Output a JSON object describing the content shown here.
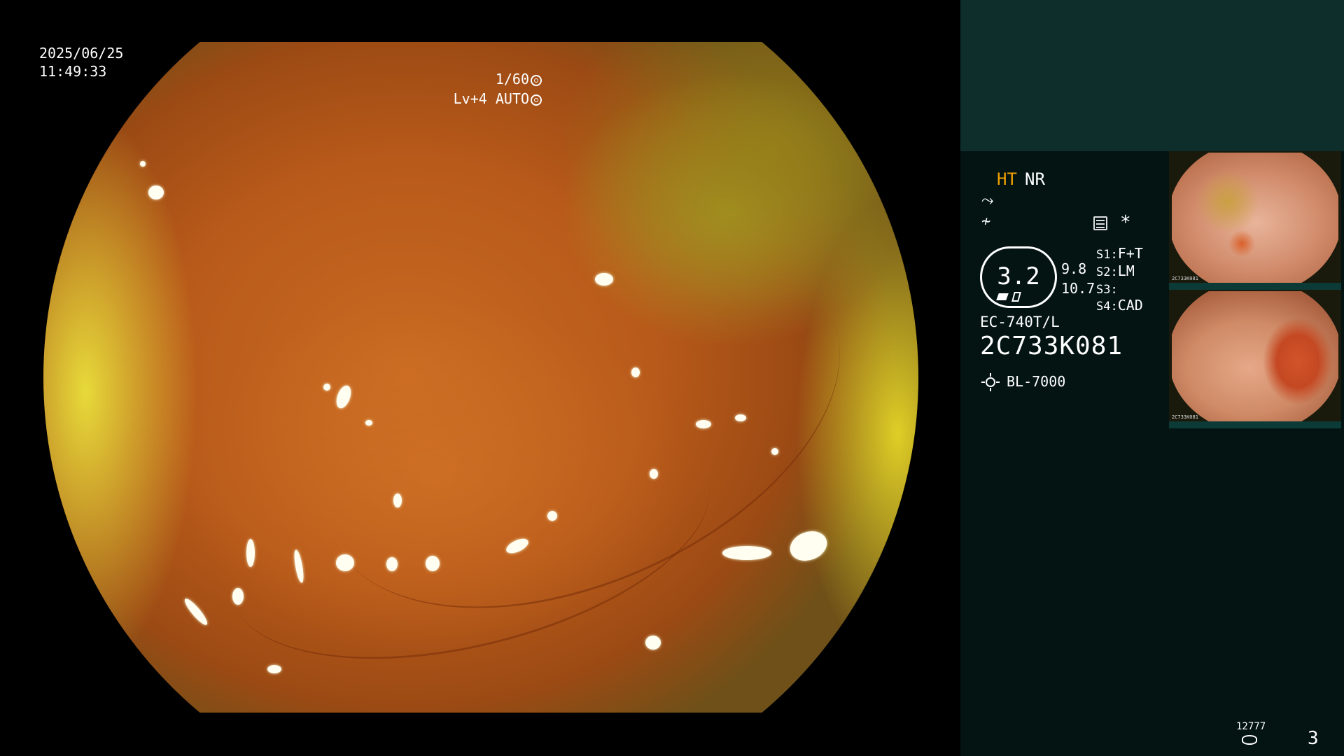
{
  "osd": {
    "date": "2025/06/25",
    "time": "11:49:33",
    "shutter": "1/60",
    "level": "Lv+4 AUTO"
  },
  "panel": {
    "mode_ht": "HT",
    "mode_nr": "NR",
    "gauge_value": "3.2",
    "value_a": "9.8",
    "value_b": "10.7",
    "slots": [
      {
        "key": "S1:",
        "value": "F+T"
      },
      {
        "key": "S2:",
        "value": "LM"
      },
      {
        "key": "S3:",
        "value": ""
      },
      {
        "key": "S4:",
        "value": "CAD"
      }
    ],
    "scope_model": "EC-740T/L",
    "scope_serial": "2C733K081",
    "light_source": "BL-7000",
    "star_symbol": "*",
    "counter": "12777",
    "page_number": "3",
    "thumbnails": [
      {
        "caption": "2C733K081"
      },
      {
        "caption": "2C733K081"
      }
    ]
  },
  "colors": {
    "background": "#000000",
    "panel": "#031413",
    "panel_top": "#0e2e2c",
    "accent_ht": "#f0a000",
    "thumb_border": "#0c3a36"
  },
  "icons": [
    "shutter-icon",
    "iris-icon",
    "enhance-icon",
    "color-icon",
    "menu-icon",
    "light-source-icon",
    "counter-icon"
  ]
}
